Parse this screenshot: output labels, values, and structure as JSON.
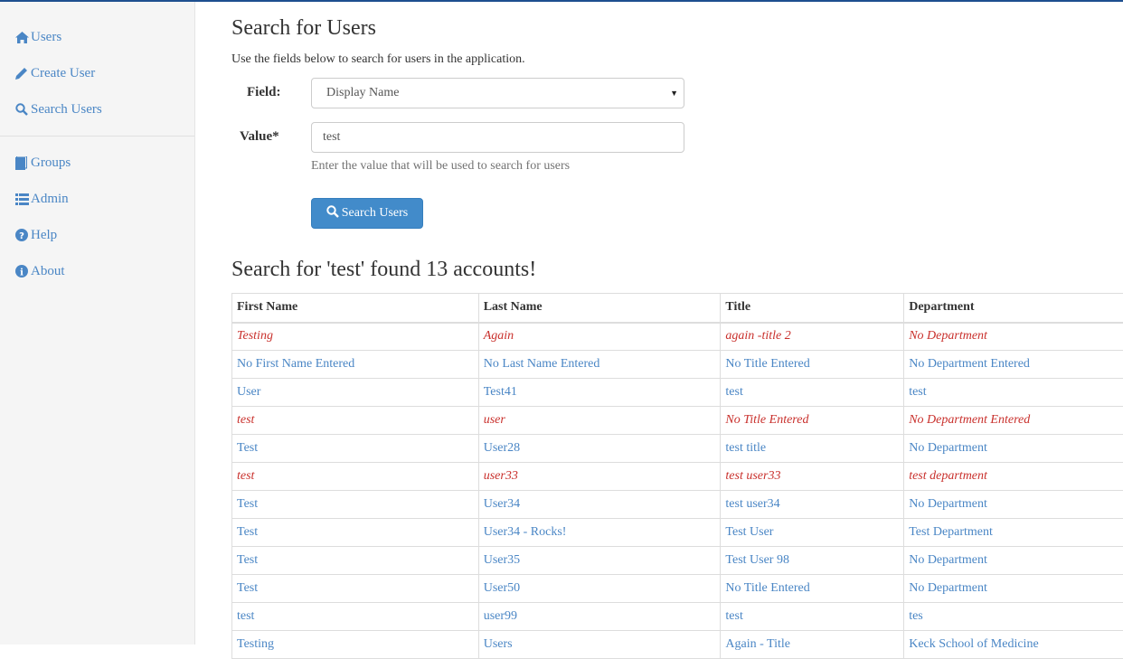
{
  "sidebar": {
    "items": [
      {
        "label": "Users",
        "icon": "home-icon"
      },
      {
        "label": "Create User",
        "icon": "pencil-icon"
      },
      {
        "label": "Search Users",
        "icon": "search-icon"
      },
      {
        "label": "Groups",
        "icon": "book-icon"
      },
      {
        "label": "Admin",
        "icon": "list-icon"
      },
      {
        "label": "Help",
        "icon": "question-circle-icon"
      },
      {
        "label": "About",
        "icon": "info-circle-icon"
      }
    ]
  },
  "search_form": {
    "title": "Search for Users",
    "description": "Use the fields below to search for users in the application.",
    "field_label": "Field:",
    "field_value": "Display Name",
    "value_label": "Value*",
    "value_input": "test",
    "help_text": "Enter the value that will be used to search for users",
    "submit_label": "Search Users"
  },
  "results": {
    "title": "Search for 'test' found 13 accounts!",
    "columns": [
      "First Name",
      "Last Name",
      "Title",
      "Department"
    ],
    "rows": [
      {
        "first": "Testing",
        "last": "Again",
        "title": "again -title 2",
        "dept": "No Department",
        "status": "disabled"
      },
      {
        "first": "No First Name Entered",
        "last": "No Last Name Entered",
        "title": "No Title Entered",
        "dept": "No Department Entered",
        "status": "active"
      },
      {
        "first": "User",
        "last": "Test41",
        "title": "test",
        "dept": "test",
        "status": "active"
      },
      {
        "first": "test",
        "last": "user",
        "title": "No Title Entered",
        "dept": "No Department Entered",
        "status": "disabled"
      },
      {
        "first": "Test",
        "last": "User28",
        "title": "test title",
        "dept": "No Department",
        "status": "active"
      },
      {
        "first": "test",
        "last": "user33",
        "title": "test user33",
        "dept": "test department",
        "status": "disabled"
      },
      {
        "first": "Test",
        "last": "User34",
        "title": "test user34",
        "dept": "No Department",
        "status": "active"
      },
      {
        "first": "Test",
        "last": "User34 - Rocks!",
        "title": "Test User",
        "dept": "Test Department",
        "status": "active"
      },
      {
        "first": "Test",
        "last": "User35",
        "title": "Test User 98",
        "dept": "No Department",
        "status": "active"
      },
      {
        "first": "Test",
        "last": "User50",
        "title": "No Title Entered",
        "dept": "No Department",
        "status": "active"
      },
      {
        "first": "test",
        "last": "user99",
        "title": "test",
        "dept": "tes",
        "status": "active"
      },
      {
        "first": "Testing",
        "last": "Users",
        "title": "Again - Title",
        "dept": "Keck School of Medicine",
        "status": "active"
      }
    ]
  },
  "colors": {
    "link": "#4a86c5",
    "disabled": "#c9302c",
    "primary_button": "#428bca",
    "top_bar": "#1e4f8f"
  }
}
